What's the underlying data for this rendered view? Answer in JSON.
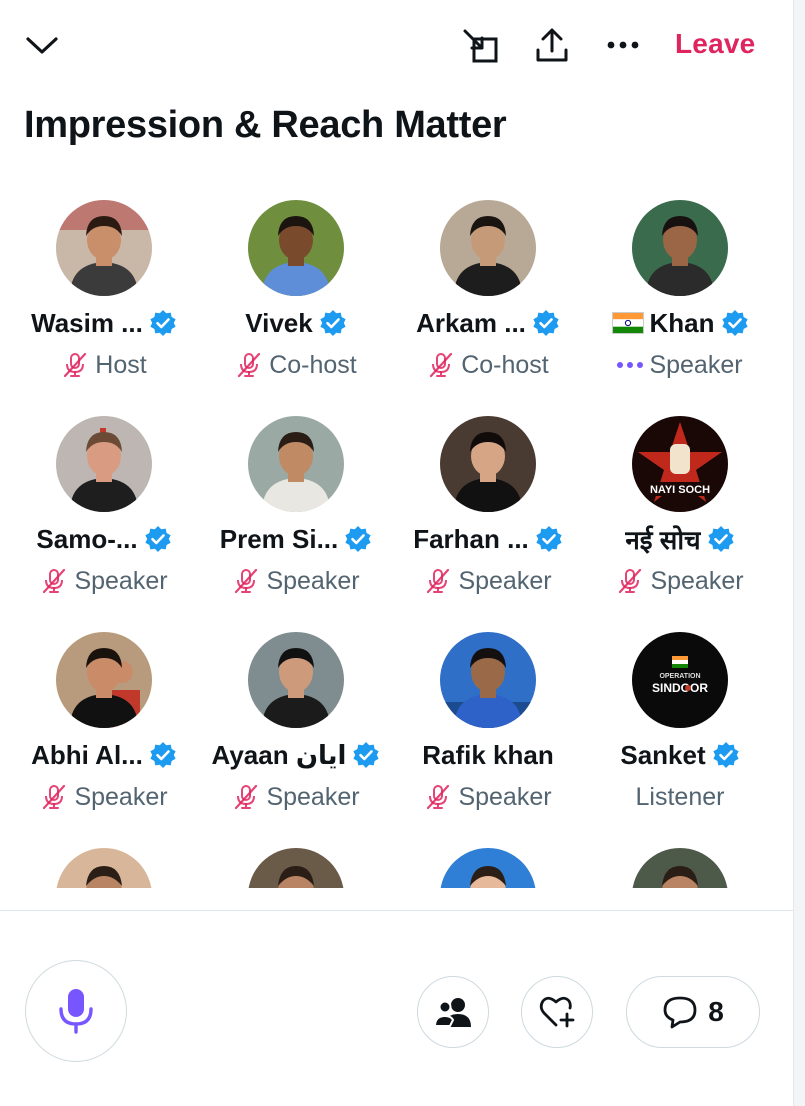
{
  "header": {
    "leave_label": "Leave"
  },
  "space": {
    "title": "Impression & Reach Matter"
  },
  "colors": {
    "accent_red": "#e0245e",
    "verified_blue": "#1d9bf0",
    "purple": "#7856ff",
    "muted_gray": "#536471"
  },
  "participants": [
    {
      "name": "Wasim ...",
      "role": "Host",
      "verified": true,
      "muted": true
    },
    {
      "name": "Vivek",
      "role": "Co-host",
      "verified": true,
      "muted": true
    },
    {
      "name": "Arkam ...",
      "role": "Co-host",
      "verified": true,
      "muted": true
    },
    {
      "name": "Khan",
      "role": "Speaker",
      "verified": true,
      "muted": false,
      "speaking": true,
      "flag": "india-flag"
    },
    {
      "name": "Samo-...",
      "role": "Speaker",
      "verified": true,
      "muted": true
    },
    {
      "name": "Prem Si...",
      "role": "Speaker",
      "verified": true,
      "muted": true
    },
    {
      "name": "Farhan ...",
      "role": "Speaker",
      "verified": true,
      "muted": true
    },
    {
      "name": "नई सोच",
      "role": "Speaker",
      "verified": true,
      "muted": true,
      "avatar_text": "NAYI SOCH"
    },
    {
      "name": "Abhi Al...",
      "role": "Speaker",
      "verified": true,
      "muted": true
    },
    {
      "name": "Ayaan ایان",
      "role": "Speaker",
      "verified": true,
      "muted": true
    },
    {
      "name": "Rafik khan",
      "role": "Speaker",
      "verified": false,
      "muted": true
    },
    {
      "name": "Sanket",
      "role": "Listener",
      "verified": true,
      "muted": false,
      "avatar_text_top": "OPERATION",
      "avatar_text_main": "SINDOOR"
    }
  ],
  "bottom_bar": {
    "comment_count": "8"
  }
}
